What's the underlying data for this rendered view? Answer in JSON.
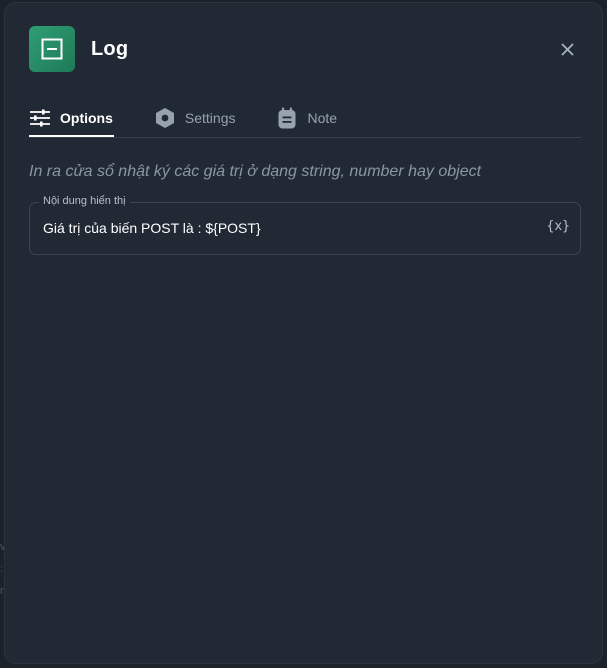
{
  "dialog": {
    "title": "Log",
    "node_icon": "log-node-icon",
    "node_icon_color": "#2a8f68",
    "close_icon": "close-icon"
  },
  "tabs": [
    {
      "label": "Options",
      "icon": "sliders-icon",
      "active": true
    },
    {
      "label": "Settings",
      "icon": "hexagon-gear-icon",
      "active": false
    },
    {
      "label": "Note",
      "icon": "notepad-icon",
      "active": false
    }
  ],
  "description": "In ra cửa sổ nhật ký các giá trị ở dạng string, number hay object",
  "field": {
    "label": "Nội dung hiển thị",
    "value": "Giá trị của biến POST là : ${POST}",
    "variable_button": "{x}"
  },
  "backdrop": {
    "glyphs": [
      "v",
      ":",
      "n"
    ]
  }
}
